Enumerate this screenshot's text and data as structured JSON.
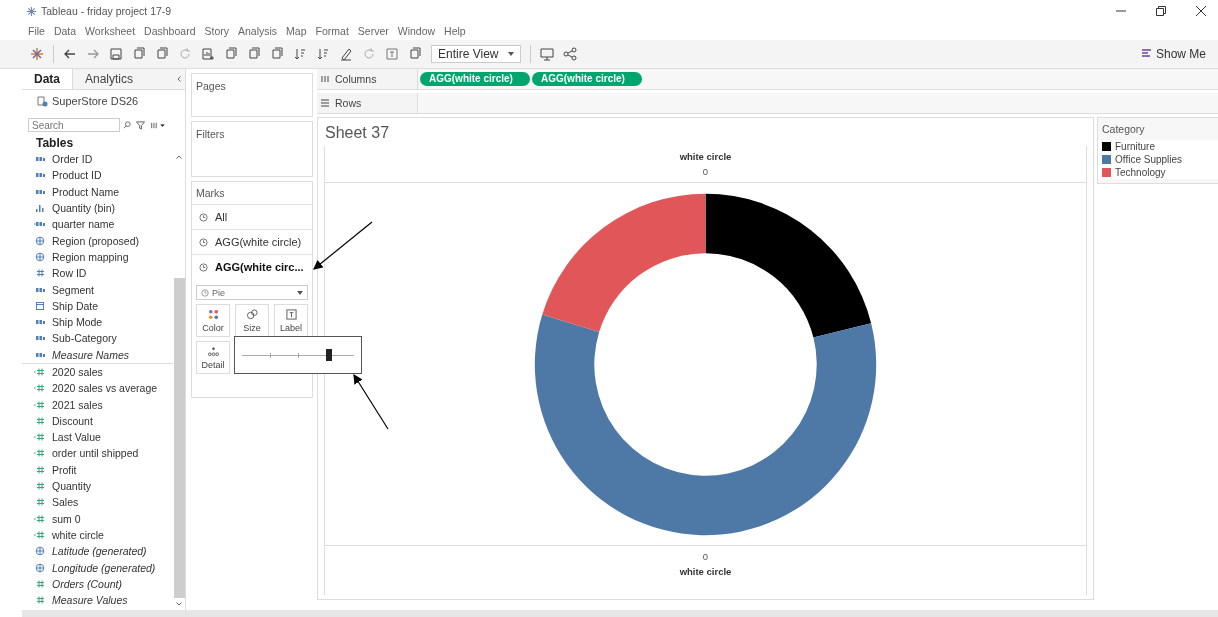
{
  "window": {
    "title": "Tableau - friday project 17-9"
  },
  "menu": [
    "File",
    "Data",
    "Worksheet",
    "Dashboard",
    "Story",
    "Analysis",
    "Map",
    "Format",
    "Server",
    "Window",
    "Help"
  ],
  "toolbar": {
    "fit": "Entire View",
    "show_me": "Show Me"
  },
  "data_pane": {
    "tabs": [
      {
        "label": "Data",
        "selected": true
      },
      {
        "label": "Analytics",
        "selected": false
      }
    ],
    "source": "SuperStore DS26",
    "search": {
      "placeholder": "Search"
    },
    "heading": "Tables",
    "fields": [
      {
        "name": "Order ID",
        "kind": "text",
        "italic": false
      },
      {
        "name": "Product ID",
        "kind": "text",
        "italic": false
      },
      {
        "name": "Product Name",
        "kind": "text",
        "italic": false
      },
      {
        "name": "Quantity (bin)",
        "kind": "bin",
        "italic": false
      },
      {
        "name": "quarter name",
        "kind": "calc-text",
        "italic": false
      },
      {
        "name": "Region (proposed)",
        "kind": "group",
        "italic": false
      },
      {
        "name": "Region mapping",
        "kind": "geo",
        "italic": false
      },
      {
        "name": "Row ID",
        "kind": "number",
        "italic": false
      },
      {
        "name": "Segment",
        "kind": "text",
        "italic": false
      },
      {
        "name": "Ship Date",
        "kind": "date",
        "italic": false
      },
      {
        "name": "Ship Mode",
        "kind": "text",
        "italic": false
      },
      {
        "name": "Sub-Category",
        "kind": "text",
        "italic": false
      },
      {
        "name": "Measure Names",
        "kind": "text",
        "italic": true
      },
      {
        "name": "2020 sales",
        "kind": "calc-measure",
        "italic": false
      },
      {
        "name": "2020 sales vs average",
        "kind": "calc-measure",
        "italic": false
      },
      {
        "name": "2021 sales",
        "kind": "calc-measure",
        "italic": false
      },
      {
        "name": "Discount",
        "kind": "measure",
        "italic": false
      },
      {
        "name": "Last Value",
        "kind": "calc-measure",
        "italic": false
      },
      {
        "name": "order until shipped",
        "kind": "calc-measure",
        "italic": false
      },
      {
        "name": "Profit",
        "kind": "measure",
        "italic": false
      },
      {
        "name": "Quantity",
        "kind": "measure",
        "italic": false
      },
      {
        "name": "Sales",
        "kind": "measure",
        "italic": false
      },
      {
        "name": "sum 0",
        "kind": "calc-measure",
        "italic": false
      },
      {
        "name": "white circle",
        "kind": "calc-measure",
        "italic": false
      },
      {
        "name": "Latitude (generated)",
        "kind": "globe",
        "italic": true
      },
      {
        "name": "Longitude (generated)",
        "kind": "globe",
        "italic": true
      },
      {
        "name": "Orders (Count)",
        "kind": "measure",
        "italic": true
      },
      {
        "name": "Measure Values",
        "kind": "measure",
        "italic": true
      }
    ]
  },
  "pages": {
    "title": "Pages"
  },
  "filters": {
    "title": "Filters"
  },
  "marks": {
    "title": "Marks",
    "cards": [
      {
        "label": "All",
        "selected": false
      },
      {
        "label": "AGG(white circle)",
        "selected": false
      },
      {
        "label": "AGG(white circ...",
        "selected": true
      }
    ],
    "mark_type": "Pie",
    "buttons": [
      {
        "label": "Color",
        "kind": "color"
      },
      {
        "label": "Size",
        "kind": "size"
      },
      {
        "label": "Label",
        "kind": "label"
      },
      {
        "label": "Detail",
        "kind": "detail"
      }
    ],
    "size_slider": {
      "level": 0.78
    }
  },
  "columns": {
    "label": "Columns",
    "pills": [
      "AGG(white circle)",
      "AGG(white circle)"
    ]
  },
  "rows": {
    "label": "Rows"
  },
  "sheet": {
    "title": "Sheet 37",
    "top_header": {
      "label": "white circle",
      "value": "0"
    },
    "bottom_header": {
      "value": "0",
      "label": "white circle"
    }
  },
  "legend": {
    "title": "Category",
    "items": [
      {
        "label": "Furniture",
        "color": "#000000"
      },
      {
        "label": "Office Supplies",
        "color": "#4e79a7"
      },
      {
        "label": "Technology",
        "color": "#e15759"
      }
    ]
  }
}
